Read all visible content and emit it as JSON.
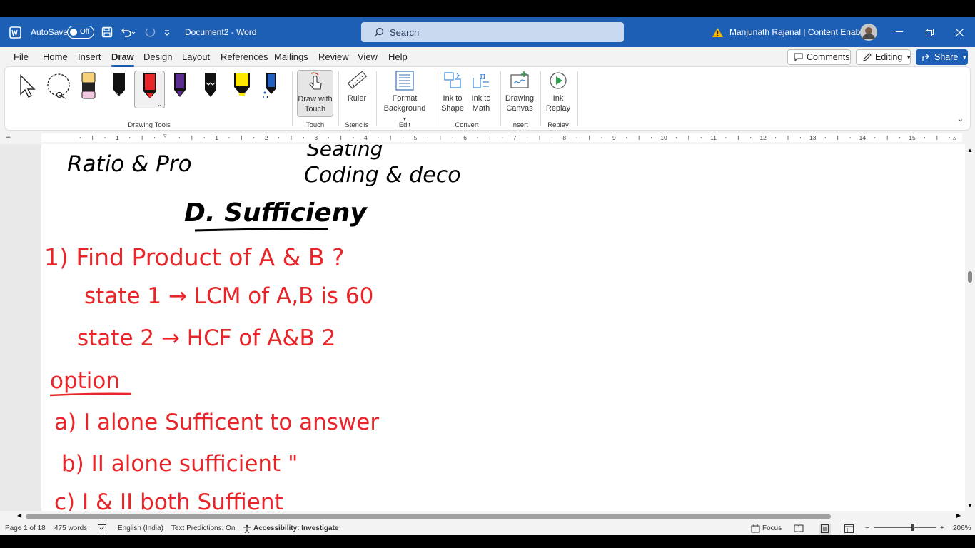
{
  "titlebar": {
    "autosave_label": "AutoSave",
    "autosave_state": "Off",
    "document_title": "Document2 - Word",
    "search_placeholder": "Search",
    "user_name": "Manjunath Rajanal | Content Enablers",
    "accent_color": "#1d5fb5"
  },
  "menu": {
    "tabs": [
      "File",
      "Home",
      "Insert",
      "Draw",
      "Design",
      "Layout",
      "References",
      "Mailings",
      "Review",
      "View",
      "Help"
    ],
    "active_tab": "Draw",
    "comments_label": "Comments",
    "editing_label": "Editing",
    "share_label": "Share"
  },
  "ribbon": {
    "groups": {
      "drawing_tools": "Drawing Tools",
      "touch": "Touch",
      "stencils": "Stencils",
      "edit": "Edit",
      "convert": "Convert",
      "insert": "Insert",
      "replay": "Replay"
    },
    "draw_with_touch_1": "Draw with",
    "draw_with_touch_2": "Touch",
    "ruler": "Ruler",
    "format_bg_1": "Format",
    "format_bg_2": "Background",
    "ink_to_shape_1": "Ink to",
    "ink_to_shape_2": "Shape",
    "ink_to_math_1": "Ink to",
    "ink_to_math_2": "Math",
    "drawing_canvas_1": "Drawing",
    "drawing_canvas_2": "Canvas",
    "ink_replay_1": "Ink",
    "ink_replay_2": "Replay",
    "pen_colors": [
      "#000000",
      "#d91e18",
      "#5b2d8e",
      "#000000",
      "#ffe800",
      "#1f5fbf"
    ],
    "highlighter_color": "#f2c9e0"
  },
  "ruler": {
    "numbers": [
      "1",
      "1",
      "2",
      "3",
      "4",
      "5",
      "6",
      "7",
      "8",
      "9",
      "10",
      "11",
      "12",
      "13",
      "14",
      "15"
    ]
  },
  "ink": {
    "heading_left": "Ratio & Pro",
    "heading_right_1": "Seating",
    "heading_right_2": "Coding & deco",
    "title": "D. Sufficieny",
    "q1": "1) Find Product of A & B ?",
    "s1": "state 1 → LCM of A,B is 60",
    "s2": "state 2 → HCF of A&B   2",
    "option": "option",
    "a": "a)  I alone Sufficent to answer",
    "b": "b)  II alone sufficient    \"",
    "c": "c)  I & II  both Suffient",
    "ink_black": "#000000",
    "ink_red": "#e8262a"
  },
  "status": {
    "page": "Page 1 of 18",
    "words": "475 words",
    "language": "English (India)",
    "predictions": "Text Predictions: On",
    "accessibility": "Accessibility: Investigate",
    "focus": "Focus",
    "zoom": "206%"
  }
}
